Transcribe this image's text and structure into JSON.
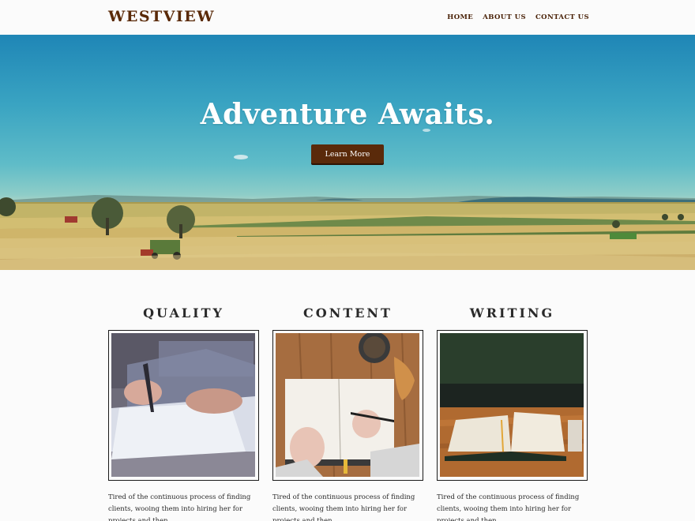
{
  "header": {
    "logo": "WESTVIEW",
    "nav": [
      "HOME",
      "ABOUT US",
      "CONTACT US"
    ]
  },
  "hero": {
    "title": "Adventure Awaits.",
    "button_label": "Learn More"
  },
  "features": [
    {
      "title": "QUALITY",
      "image": "person-signing-document",
      "text": "Tired of the continuous process of finding clients, wooing them into hiring her for projects and then"
    },
    {
      "title": "CONTENT",
      "image": "writing-in-notebook-with-coffee",
      "text": "Tired of the continuous process of finding clients, wooing them into hiring her for projects and then"
    },
    {
      "title": "WRITING",
      "image": "open-book-on-table",
      "text": "Tired of the continuous process of finding clients, wooing them into hiring her for projects and then"
    }
  ],
  "colors": {
    "brand": "#5a2a08",
    "button": "#5a2a0a",
    "text": "#2a2a2a",
    "background": "#fbfbfb"
  }
}
